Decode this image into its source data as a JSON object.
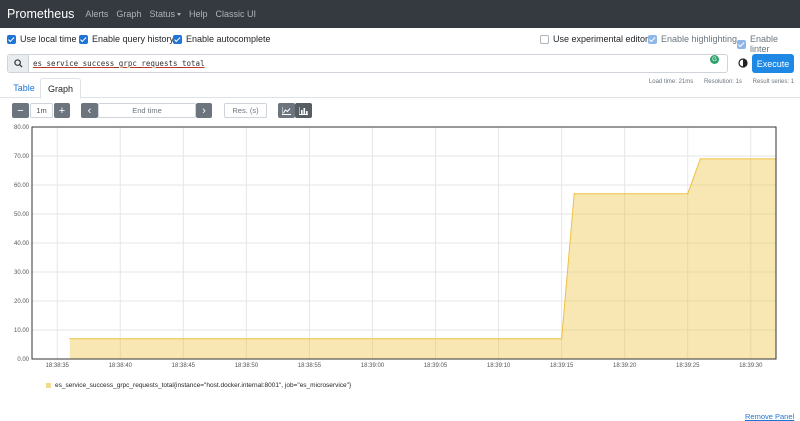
{
  "navbar": {
    "brand": "Prometheus",
    "links": [
      "Alerts",
      "Graph",
      "Status",
      "Help",
      "Classic UI"
    ]
  },
  "options": {
    "local_time": "Use local time",
    "query_history": "Enable query history",
    "autocomplete": "Enable autocomplete",
    "experimental": "Use experimental editor",
    "highlighting": "Enable highlighting",
    "linter": "Enable linter"
  },
  "query": {
    "expression": "es_service_success_grpc_requests_total",
    "execute_label": "Execute"
  },
  "stats": {
    "load_time": "Load time: 21ms",
    "resolution": "Resolution: 1s",
    "result_series": "Result series: 1"
  },
  "tabs": {
    "table": "Table",
    "graph": "Graph"
  },
  "controls": {
    "minus": "−",
    "range": "1m",
    "plus": "+",
    "prev": "‹",
    "end_time_placeholder": "End time",
    "next": "›",
    "res_placeholder": "Res. (s)"
  },
  "legend": {
    "metric": "es_service_success_grpc_requests_total",
    "labels": "{instance=\"host.docker.internal:8001\", job=\"es_microservice\"}"
  },
  "remove_panel": "Remove Panel",
  "colors": {
    "series": "#edc240",
    "navbar": "#343a40",
    "accent": "#1e75d6"
  },
  "chart_data": {
    "type": "area",
    "y_ticks": [
      "0.00",
      "10.00",
      "20.00",
      "30.00",
      "40.00",
      "50.00",
      "60.00",
      "70.00",
      "80.00"
    ],
    "ylim": [
      0,
      80
    ],
    "x_ticks": [
      "18:38:35",
      "18:38:40",
      "18:38:45",
      "18:38:50",
      "18:38:55",
      "18:39:00",
      "18:39:05",
      "18:39:10",
      "18:39:15",
      "18:39:20",
      "18:39:25",
      "18:39:30"
    ],
    "xlim": [
      "18:38:33",
      "18:39:32"
    ],
    "series": [
      {
        "name": "es_service_success_grpc_requests_total{instance=\"host.docker.internal:8001\", job=\"es_microservice\"}",
        "x": [
          "18:38:36",
          "18:39:15",
          "18:39:16",
          "18:39:25",
          "18:39:26",
          "18:39:32"
        ],
        "values": [
          7,
          7,
          57,
          57,
          69,
          69
        ]
      }
    ]
  }
}
